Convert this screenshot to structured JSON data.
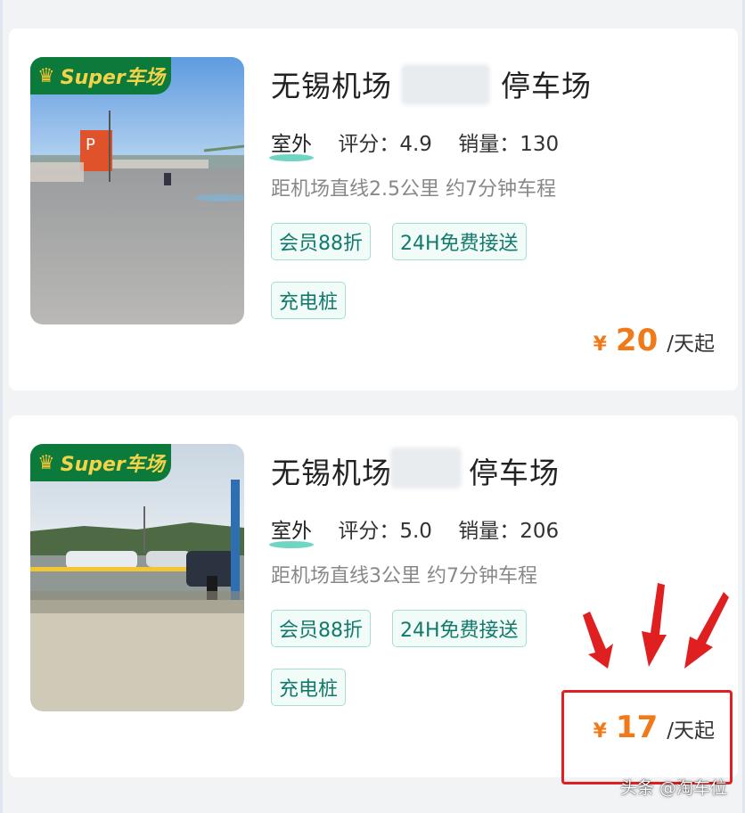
{
  "listings": [
    {
      "badge": "Super车场",
      "title": "无锡机场",
      "title_suffix": "停车场",
      "outdoor": "室外",
      "rating_label": "评分：",
      "rating": "4.9",
      "sales_label": "销量：",
      "sales": "130",
      "distance": "距机场直线2.5公里 约7分钟车程",
      "tags": [
        "会员88折",
        "24H免费接送",
        "充电桩"
      ],
      "price_symbol": "¥",
      "price": "20",
      "price_unit": "/天起"
    },
    {
      "badge": "Super车场",
      "title": "无锡机场",
      "title_suffix": "停车场",
      "outdoor": "室外",
      "rating_label": "评分：",
      "rating": "5.0",
      "sales_label": "销量：",
      "sales": "206",
      "distance": "距机场直线3公里 约7分钟车程",
      "tags": [
        "会员88折",
        "24H免费接送",
        "充电桩"
      ],
      "price_symbol": "¥",
      "price": "17",
      "price_unit": "/天起"
    }
  ],
  "watermark": "头条 @淘车位",
  "colors": {
    "accent_price": "#f07a1a",
    "tag_text": "#127a6c",
    "tag_border": "#a9ddd3",
    "badge_bg": "#0b7a3a",
    "highlight_red": "#e02020"
  }
}
